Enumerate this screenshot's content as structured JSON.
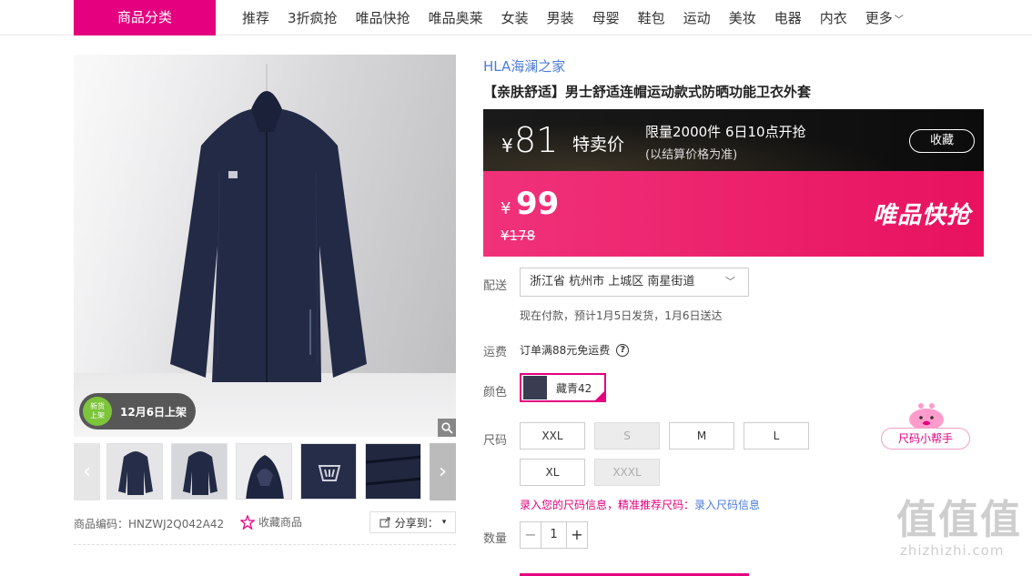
{
  "nav": {
    "category_button": "商品分类",
    "links": [
      "推荐",
      "3折疯抢",
      "唯品快抢",
      "唯品奥莱",
      "女装",
      "男装",
      "母婴",
      "鞋包",
      "运动",
      "美妆",
      "电器",
      "内衣"
    ],
    "more": "更多"
  },
  "gallery": {
    "new_badge_line1": "新货",
    "new_badge_line2": "上架",
    "new_badge_text": "12月6日上架",
    "thumb_count": 5
  },
  "product_meta": {
    "sku": "商品编码：HNZWJ2Q042A42",
    "favorite": "收藏商品",
    "share": "分享到："
  },
  "product": {
    "brand": "HLA海澜之家",
    "title": "【亲肤舒适】男士舒适连帽运动款式防晒功能卫衣外套"
  },
  "special_price": {
    "currency": "¥",
    "price": "81",
    "label": "特卖价",
    "limit": "限量2000件 6日10点开抢",
    "note": "(以结算价格为准)",
    "favorite": "收藏"
  },
  "flash_price": {
    "currency": "¥",
    "price": "99",
    "original": "¥178",
    "label": "唯品快抢"
  },
  "delivery": {
    "label": "配送",
    "address": "浙江省 杭州市 上城区 南星街道",
    "note": "现在付款，预计1月5日发货，1月6日送达"
  },
  "shipping_fee": {
    "label": "运费",
    "text": "订单满88元免运费"
  },
  "color": {
    "label": "颜色",
    "selected": "藏青42"
  },
  "size": {
    "label": "尺码",
    "options": [
      {
        "name": "XXL",
        "available": true
      },
      {
        "name": "S",
        "available": false
      },
      {
        "name": "M",
        "available": true
      },
      {
        "name": "L",
        "available": true
      },
      {
        "name": "XL",
        "available": true
      },
      {
        "name": "XXXL",
        "available": false
      }
    ],
    "help_text": "录入您的尺码信息，精准推荐尺码：",
    "help_link": "录入尺码信息",
    "helper_button": "尺码小帮手"
  },
  "quantity": {
    "label": "数量",
    "value": "1",
    "minus": "−",
    "plus": "+"
  },
  "watermark": {
    "big": "值值值",
    "small": "zhizhizhi.com"
  },
  "colors": {
    "accent": "#e4007f",
    "link": "#4b7bd6",
    "flash_bg": "#ec1e68"
  }
}
